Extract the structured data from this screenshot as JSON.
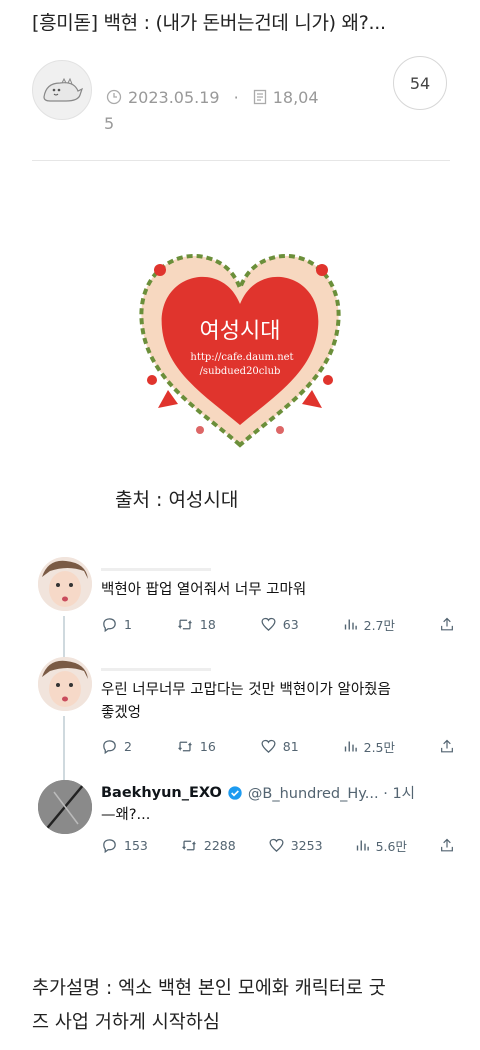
{
  "post": {
    "title": "[흥미돋] 백현 : (내가 돈버는건데 니가) 왜?...",
    "date": "2023.05.19",
    "views_part1": "18,04",
    "views_part2": "5",
    "comment_count": "54"
  },
  "logo": {
    "name": "여성시대",
    "url_line1": "http://cafe.daum.net",
    "url_line2": "/subdued20club"
  },
  "source_text": "출처 : 여성시대",
  "tweets": [
    {
      "text": "백현아 팝업 열어줘서 너무 고마워",
      "replies": "1",
      "retweets": "18",
      "likes": "63",
      "views": "2.7만"
    },
    {
      "text_line1": "우린 너무너무 고맙다는 것만 백현이가 알아줬음",
      "text_line2": "좋겠엉",
      "replies": "2",
      "retweets": "16",
      "likes": "81",
      "views": "2.5만"
    },
    {
      "name": "Baekhyun_EXO",
      "handle": "@B_hundred_Hy... · 1시",
      "text": "—왜?...",
      "replies": "153",
      "retweets": "2288",
      "likes": "3253",
      "views": "5.6만"
    }
  ],
  "extra_line1": "추가설명 : 엑소 백현 본인 모에화 캐릭터로 굿",
  "extra_line2": "즈 사업 거하게 시작하심",
  "colors": {
    "heart_red": "#e0342d",
    "meta_gray": "#999999",
    "verified_blue": "#1d9bf0"
  },
  "icons": [
    "clock-icon",
    "document-icon",
    "reply-icon",
    "retweet-icon",
    "heart-icon",
    "views-icon",
    "share-icon",
    "verified-icon"
  ]
}
